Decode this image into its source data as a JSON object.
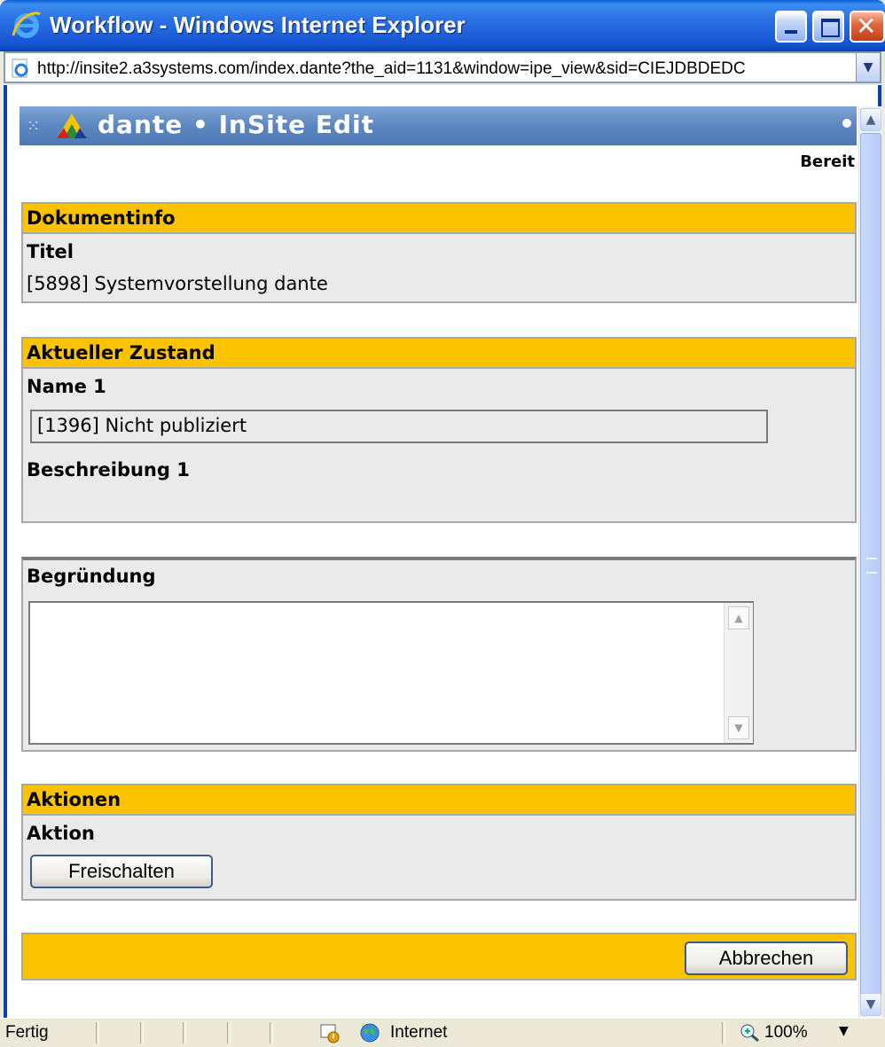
{
  "window": {
    "title": "Workflow - Windows Internet Explorer",
    "url": "http://insite2.a3systems.com/index.dante?the_aid=1131&window=ipe_view&sid=CIEJDBDEDC"
  },
  "app": {
    "title": "dante • InSite Edit",
    "status": "Bereit"
  },
  "dokumentinfo": {
    "heading": "Dokumentinfo",
    "title_label": "Titel",
    "title_value": "[5898] Systemvorstellung dante"
  },
  "zustand": {
    "heading": "Aktueller Zustand",
    "name_label": "Name 1",
    "name_value": "[1396] Nicht publiziert",
    "desc_label": "Beschreibung 1"
  },
  "begruendung": {
    "label": "Begründung",
    "value": ""
  },
  "aktionen": {
    "heading": "Aktionen",
    "action_label": "Aktion",
    "button": "Freischalten"
  },
  "footer": {
    "cancel": "Abbrechen"
  },
  "statusbar": {
    "text": "Fertig",
    "zone": "Internet",
    "zoom": "100%"
  },
  "colors": {
    "section_header": "#fbc200",
    "app_header": "#5b86c0"
  },
  "icons": [
    "ie-logo-icon",
    "minimize-icon",
    "maximize-icon",
    "close-icon",
    "page-icon",
    "dropdown-icon",
    "dante-logo-icon",
    "security-icon",
    "globe-icon",
    "zoom-icon"
  ]
}
